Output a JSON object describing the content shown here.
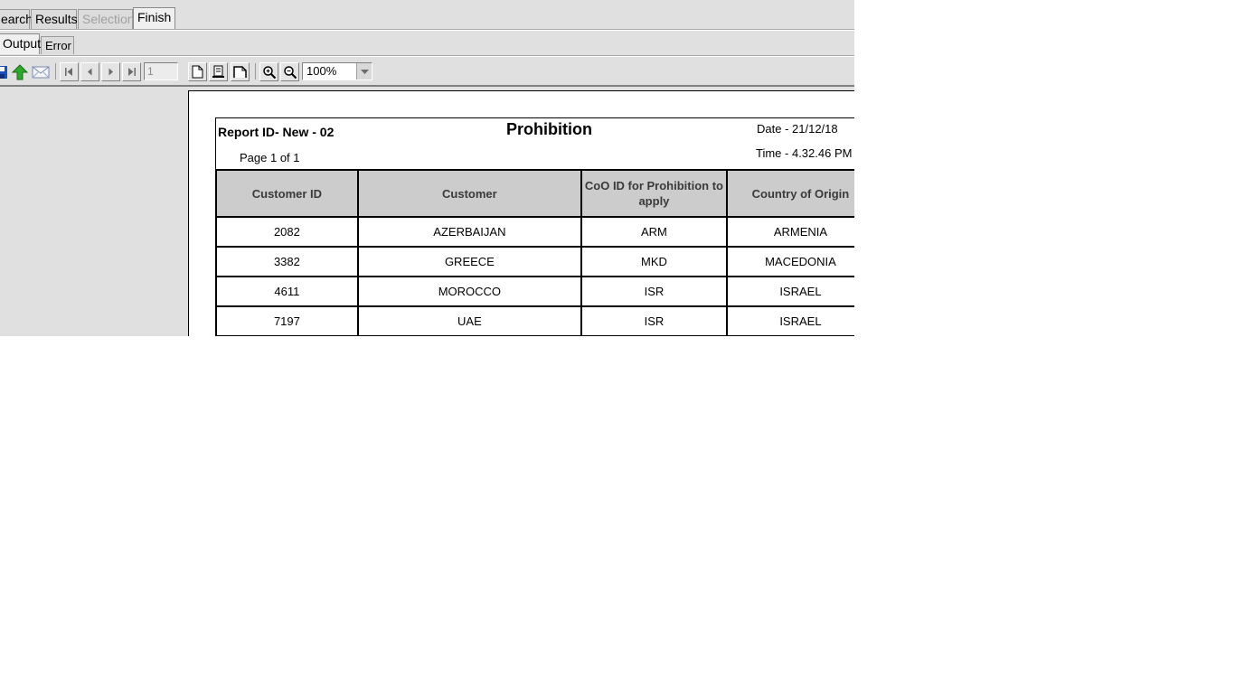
{
  "tabs": [
    {
      "label": "earch",
      "state": "normal"
    },
    {
      "label": "Results",
      "state": "normal"
    },
    {
      "label": "Selection",
      "state": "disabled"
    },
    {
      "label": "Finish",
      "state": "active"
    }
  ],
  "subtabs": [
    {
      "label": "Output",
      "state": "active"
    },
    {
      "label": "Error",
      "state": "normal"
    }
  ],
  "toolbar": {
    "icons": [
      "save-icon",
      "export-icon",
      "email-icon",
      "first-page-icon",
      "previous-page-icon",
      "next-page-icon",
      "last-page-icon",
      "single-page-icon",
      "page-width-icon",
      "whole-page-icon",
      "zoom-in-icon",
      "zoom-out-icon"
    ],
    "page_number": "1",
    "zoom": "100%"
  },
  "report": {
    "id_label": "Report ID- New - 02",
    "title": "Prohibition",
    "date": "Date - 21/12/18",
    "time": "Time - 4.32.46 PM",
    "page": "Page 1 of 1",
    "columns": [
      "Customer ID",
      "Customer",
      "CoO ID for Prohibition to apply",
      "Country of Origin"
    ],
    "rows": [
      [
        "2082",
        "AZERBAIJAN",
        "ARM",
        "ARMENIA"
      ],
      [
        "3382",
        "GREECE",
        "MKD",
        "MACEDONIA"
      ],
      [
        "4611",
        "MOROCCO",
        "ISR",
        "ISRAEL"
      ],
      [
        "7197",
        "UAE",
        "ISR",
        "ISRAEL"
      ]
    ]
  },
  "colors": {
    "window_bg": "#e0e0e0",
    "header_cell_bg": "#cccccc",
    "export_icon": "#2ea82e",
    "save_icon": "#1a4fbf"
  }
}
